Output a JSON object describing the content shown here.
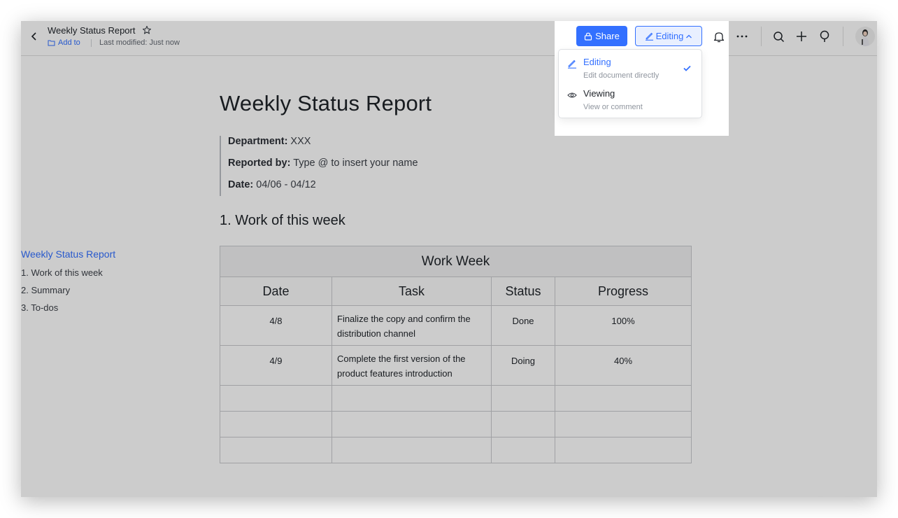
{
  "header": {
    "title": "Weekly Status Report",
    "add_to": "Add to",
    "last_modified": "Last modified: Just now",
    "share_label": "Share",
    "mode_label": "Editing"
  },
  "mode_menu": {
    "items": [
      {
        "label": "Editing",
        "description": "Edit document directly",
        "selected": true
      },
      {
        "label": "Viewing",
        "description": "View or comment",
        "selected": false
      }
    ]
  },
  "toc": {
    "items": [
      "Weekly Status Report",
      "1. Work of this week",
      "2. Summary",
      "3. To-dos"
    ]
  },
  "document": {
    "title": "Weekly Status Report",
    "meta": [
      {
        "key": "Department:",
        "value": " XXX"
      },
      {
        "key": "Reported by:",
        "value": " Type @ to insert your name"
      },
      {
        "key": "Date:",
        "value": " 04/06 - 04/12"
      }
    ],
    "section1": "1. Work of this week",
    "table": {
      "caption": "Work Week",
      "headers": [
        "Date",
        "Task",
        "Status",
        "Progress"
      ],
      "rows": [
        [
          "4/8",
          "Finalize the copy and confirm the distribution channel",
          "Done",
          "100%"
        ],
        [
          "4/9",
          "Complete the first version of the product features introduction",
          "Doing",
          "40%"
        ]
      ]
    }
  },
  "colors": {
    "accent": "#3370ff",
    "text": "#1f2329",
    "muted": "#646a73"
  },
  "icons": [
    "back-arrow-icon",
    "star-icon",
    "folder-icon",
    "lock-icon",
    "pencil-icon",
    "chevron-up-icon",
    "bell-icon",
    "more-icon",
    "search-icon",
    "plus-icon",
    "lightbulb-icon",
    "eye-icon",
    "check-icon",
    "copy-icon",
    "help-icon"
  ]
}
